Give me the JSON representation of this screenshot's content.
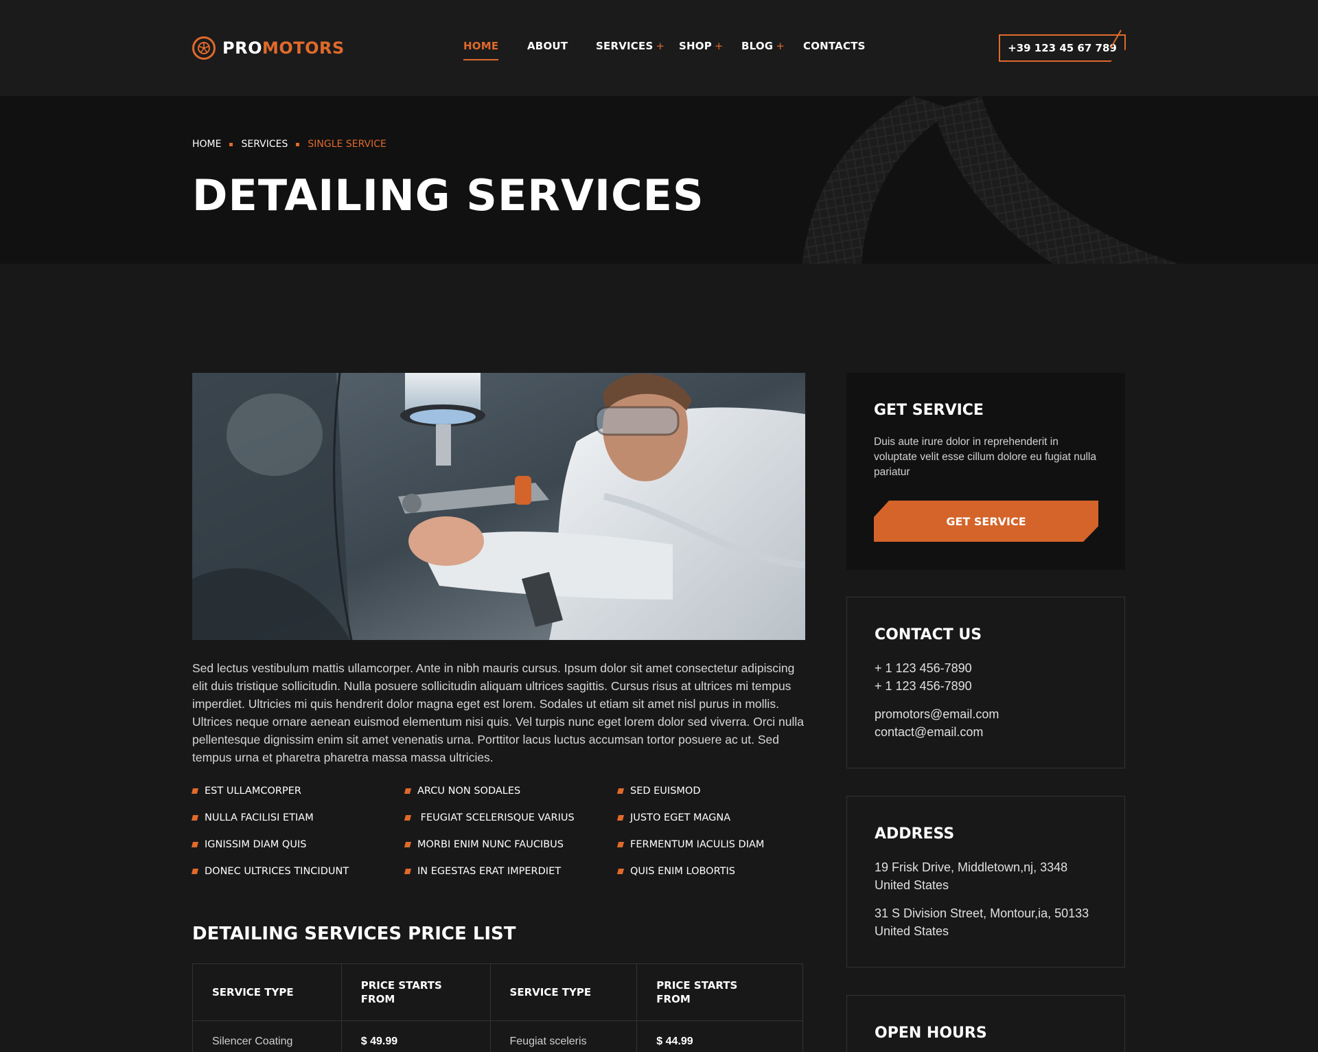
{
  "brand": {
    "pro": "PRO",
    "motors": "MOTORS",
    "accent_color": "#e06a2b"
  },
  "nav": {
    "items": [
      {
        "label": "HOME",
        "active": true,
        "has_submenu": false
      },
      {
        "label": "ABOUT",
        "active": false,
        "has_submenu": false
      },
      {
        "label": "SERVICES",
        "active": false,
        "has_submenu": true
      },
      {
        "label": "SHOP",
        "active": false,
        "has_submenu": true
      },
      {
        "label": "BLOG",
        "active": false,
        "has_submenu": true
      },
      {
        "label": "CONTACTS",
        "active": false,
        "has_submenu": false
      }
    ],
    "submenu_marker": "+"
  },
  "header": {
    "phone": "+39 123 45 67 789"
  },
  "hero": {
    "breadcrumb": [
      "HOME",
      "SERVICES",
      "SINGLE SERVICE"
    ],
    "title": "DETAILING SERVICES"
  },
  "main": {
    "body_text": "Sed lectus vestibulum mattis ullamcorper. Ante in nibh mauris cursus. Ipsum dolor sit amet consectetur adipiscing elit duis tristique sollicitudin. Nulla posuere sollicitudin aliquam ultrices sagittis. Cursus risus at ultrices mi tempus imperdiet. Ultricies mi quis hendrerit dolor magna eget est lorem. Sodales ut etiam sit amet nisl purus in mollis. Ultrices neque ornare aenean euismod elementum nisi quis. Vel turpis nunc eget lorem dolor sed viverra. Orci nulla pellentesque dignissim enim sit amet venenatis urna. Porttitor lacus luctus accumsan tortor posuere ac ut. Sed tempus urna et pharetra pharetra massa massa ultricies.",
    "features": [
      [
        "EST ULLAMCORPER",
        "NULLA FACILISI ETIAM",
        "IGNISSIM DIAM QUIS",
        "DONEC ULTRICES TINCIDUNT"
      ],
      [
        "ARCU NON SODALES",
        " FEUGIAT SCELERISQUE VARIUS",
        "MORBI ENIM NUNC FAUCIBUS",
        "IN EGESTAS ERAT IMPERDIET"
      ],
      [
        "SED EUISMOD",
        "JUSTO EGET MAGNA",
        "FERMENTUM IACULIS DIAM",
        "QUIS ENIM LOBORTIS"
      ]
    ],
    "price_list": {
      "title": "DETAILING SERVICES PRICE LIST",
      "headers": [
        "SERVICE TYPE",
        "PRICE STARTS FROM",
        "SERVICE TYPE",
        "PRICE STARTS FROM"
      ],
      "header_lines": [
        [
          "SERVICE TYPE"
        ],
        [
          "PRICE STARTS",
          "FROM"
        ],
        [
          "SERVICE TYPE"
        ],
        [
          "PRICE STARTS",
          "FROM"
        ]
      ],
      "rows": [
        [
          "Silencer Coating",
          "$ 49.99",
          "Feugiat sceleris",
          "$ 44.99"
        ]
      ]
    }
  },
  "sidebar": {
    "get_service": {
      "title": "GET SERVICE",
      "text": "Duis aute irure dolor in reprehenderit in voluptate velit esse cillum dolore eu fugiat nulla pariatur",
      "button": "GET SERVICE"
    },
    "contact": {
      "title": "CONTACT US",
      "phones": [
        "+ 1 123 456-7890",
        "+ 1 123 456-7890"
      ],
      "emails": [
        "promotors@email.com",
        "contact@email.com"
      ]
    },
    "address": {
      "title": "ADDRESS",
      "lines": [
        [
          "19 Frisk Drive, Middletown,nj, 3348",
          "United States"
        ],
        [
          "31 S Division Street, Montour,ia, 50133",
          "United States"
        ]
      ]
    },
    "hours": {
      "title": "OPEN HOURS"
    }
  }
}
